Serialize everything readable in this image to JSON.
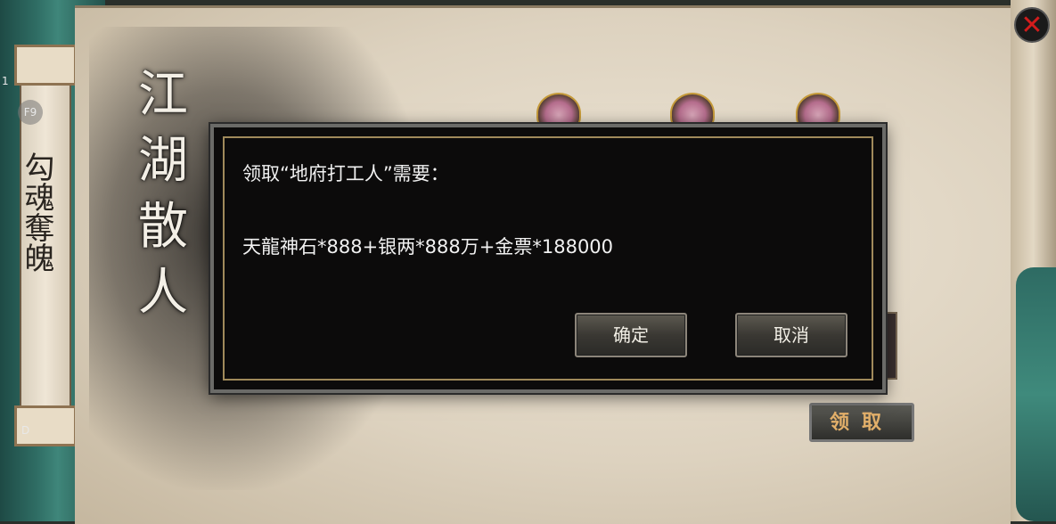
{
  "side_labels": {
    "num": "1",
    "f9": "F9",
    "d": "D"
  },
  "scroll": {
    "vertical_title": "勾魂奪魄",
    "calligraphy": "江湖散人"
  },
  "close_button": {
    "icon": "close-icon",
    "color": "#d21c1c"
  },
  "rewards": [
    {
      "icon": "mask-reward-icon"
    },
    {
      "icon": "mask-reward-icon"
    },
    {
      "icon": "mask-reward-icon"
    }
  ],
  "claim_button_label": "领取",
  "dialog": {
    "title": "领取“地府打工人”需要：",
    "cost": "天龍神石*888+银两*888万+金票*188000",
    "confirm_label": "确定",
    "cancel_label": "取消"
  },
  "colors": {
    "dialog_bg": "#0c0b0b",
    "dialog_border_gold": "#a08a5b",
    "text": "#f1f1f1",
    "claim_text": "#e3b06a"
  }
}
